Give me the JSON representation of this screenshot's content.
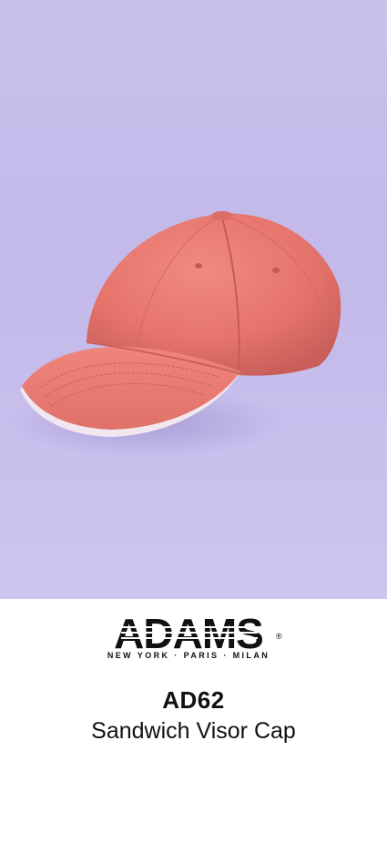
{
  "product": {
    "brand": "ADAMS",
    "brand_tagline": "NEW YORK · PARIS · MILAN",
    "brand_registered": "®",
    "sku": "AD62",
    "name": "Sandwich Visor Cap"
  },
  "image": {
    "subject": "cap",
    "cap_color": "#e8766e",
    "background_color": "#c6bdeb"
  }
}
